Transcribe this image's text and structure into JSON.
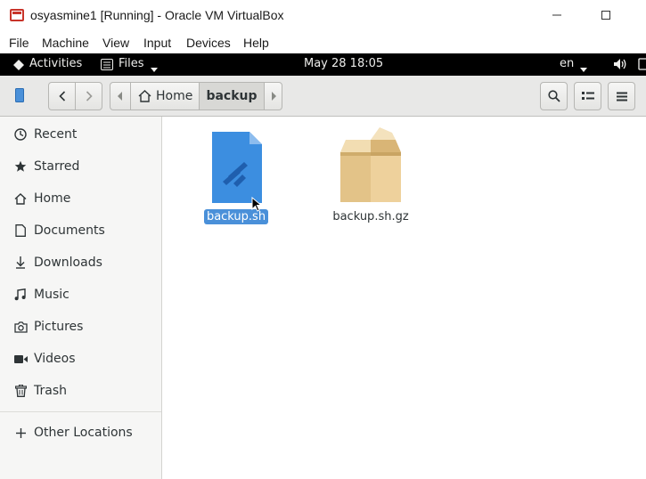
{
  "window": {
    "title": "osyasmine1 [Running] - Oracle VM VirtualBox"
  },
  "vbox_menu": [
    "File",
    "Machine",
    "View",
    "Input",
    "Devices",
    "Help"
  ],
  "gnome_bar": {
    "activities": "Activities",
    "app_menu": "Files",
    "clock": "May 28  18:05",
    "input_source": "en"
  },
  "path": {
    "home": "Home",
    "current": "backup"
  },
  "sidebar": {
    "items": [
      {
        "label": "Recent",
        "icon": "clock-icon"
      },
      {
        "label": "Starred",
        "icon": "star-icon"
      },
      {
        "label": "Home",
        "icon": "home-icon"
      },
      {
        "label": "Documents",
        "icon": "document-icon"
      },
      {
        "label": "Downloads",
        "icon": "download-icon"
      },
      {
        "label": "Music",
        "icon": "music-icon"
      },
      {
        "label": "Pictures",
        "icon": "camera-icon"
      },
      {
        "label": "Videos",
        "icon": "video-icon"
      },
      {
        "label": "Trash",
        "icon": "trash-icon"
      }
    ],
    "other_locations": "Other Locations"
  },
  "files": [
    {
      "name": "backup.sh",
      "selected": true,
      "icon": "script-file-icon"
    },
    {
      "name": "backup.sh.gz",
      "selected": false,
      "icon": "archive-file-icon"
    }
  ],
  "colors": {
    "selection": "#4a90d9",
    "script_icon": "#3c8ee0",
    "archive_icon": "#e8c98c"
  }
}
